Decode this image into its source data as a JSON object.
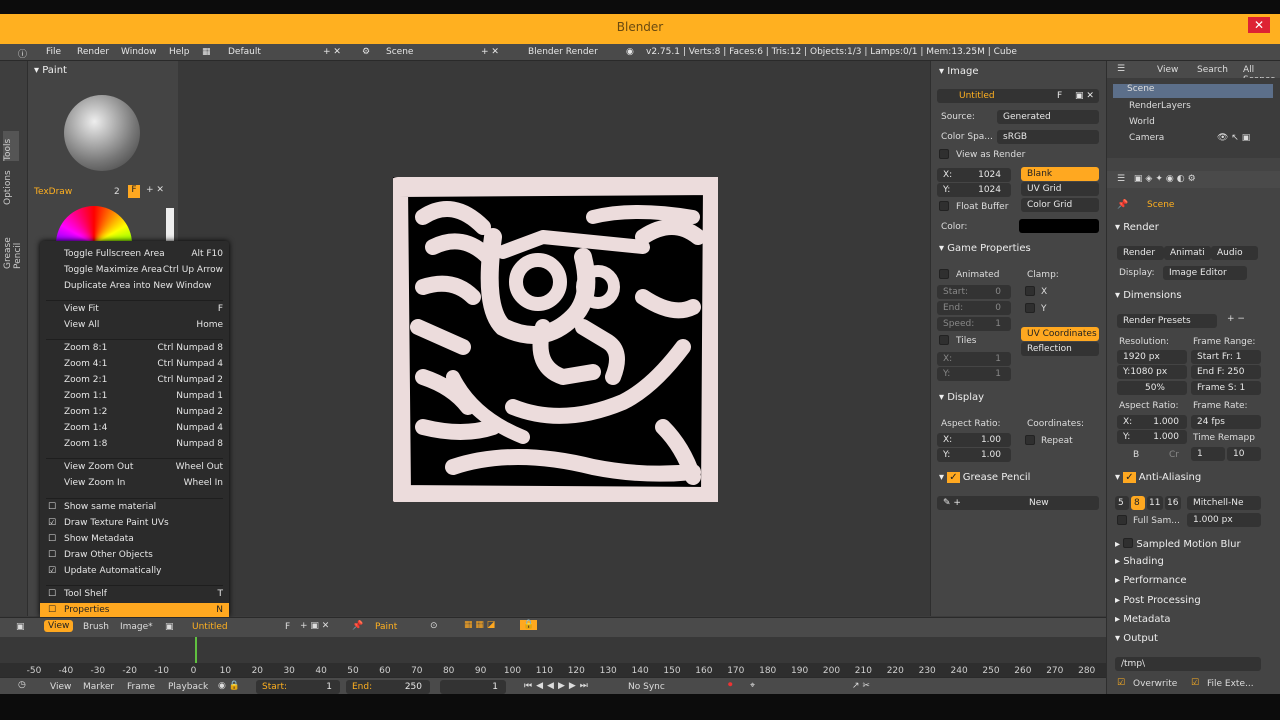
{
  "app": {
    "title": "Blender",
    "close_label": "✕"
  },
  "topbar": {
    "menus": [
      "File",
      "Render",
      "Window",
      "Help"
    ],
    "layout": "Default",
    "scene": "Scene",
    "engine": "Blender Render",
    "stats": "v2.75.1 | Verts:8 | Faces:6 | Tris:12 | Objects:1/3 | Lamps:0/1 | Mem:13.25M | Cube"
  },
  "tools": {
    "tabs": [
      "Tools",
      "Options",
      "Grease Pencil"
    ],
    "panel_title": "Paint",
    "brush_name": "TexDraw",
    "brush_users": "2",
    "brush_fake": "F"
  },
  "context_menu": {
    "items": [
      {
        "label": "Toggle Fullscreen Area",
        "key": "Alt F10"
      },
      {
        "label": "Toggle Maximize Area",
        "key": "Ctrl Up Arrow"
      },
      {
        "label": "Duplicate Area into New Window",
        "key": ""
      },
      {
        "label": "View Fit",
        "key": "F"
      },
      {
        "label": "View All",
        "key": "Home"
      },
      {
        "label": "Zoom 8:1",
        "key": "Ctrl Numpad 8"
      },
      {
        "label": "Zoom 4:1",
        "key": "Ctrl Numpad 4"
      },
      {
        "label": "Zoom 2:1",
        "key": "Ctrl Numpad 2"
      },
      {
        "label": "Zoom 1:1",
        "key": "Numpad 1"
      },
      {
        "label": "Zoom 1:2",
        "key": "Numpad 2"
      },
      {
        "label": "Zoom 1:4",
        "key": "Numpad 4"
      },
      {
        "label": "Zoom 1:8",
        "key": "Numpad 8"
      },
      {
        "label": "View Zoom Out",
        "key": "Wheel Out"
      },
      {
        "label": "View Zoom In",
        "key": "Wheel In"
      },
      {
        "label": "Show same material",
        "key": ""
      },
      {
        "label": "Draw Texture Paint UVs",
        "key": ""
      },
      {
        "label": "Show Metadata",
        "key": ""
      },
      {
        "label": "Draw Other Objects",
        "key": ""
      },
      {
        "label": "Update Automatically",
        "key": ""
      },
      {
        "label": "Tool Shelf",
        "key": "T"
      },
      {
        "label": "Properties",
        "key": "N"
      }
    ]
  },
  "image_panel": {
    "title": "Image",
    "image_name": "Untitled",
    "fake": "F",
    "source_label": "Source:",
    "source": "Generated",
    "colorspace_label": "Color Spa...",
    "colorspace": "sRGB",
    "view_as_render": "View as Render",
    "x_label": "X:",
    "x": "1024",
    "y_label": "Y:",
    "y": "1024",
    "types": [
      "Blank",
      "UV Grid",
      "Color Grid"
    ],
    "float_buffer": "Float Buffer",
    "color_label": "Color:"
  },
  "game_panel": {
    "title": "Game Properties",
    "animated": "Animated",
    "clamp": "Clamp:",
    "start": "Start:",
    "start_v": "0",
    "end": "End:",
    "end_v": "0",
    "speed": "Speed:",
    "speed_v": "1",
    "cx": "X",
    "cy": "Y",
    "tiles": "Tiles",
    "tx": "X:",
    "tx_v": "1",
    "ty": "Y:",
    "ty_v": "1",
    "mapping": [
      "UV Coordinates",
      "Reflection"
    ]
  },
  "display_panel": {
    "title": "Display",
    "aspect": "Aspect Ratio:",
    "coords": "Coordinates:",
    "ax": "X:",
    "ax_v": "1.00",
    "ay": "Y:",
    "ay_v": "1.00",
    "repeat": "Repeat"
  },
  "grease_panel": {
    "title": "Grease Pencil",
    "new": "New"
  },
  "outliner": {
    "menus": [
      "View",
      "Search",
      "All Scenes"
    ],
    "items": [
      "Scene",
      "RenderLayers",
      "World",
      "Camera"
    ]
  },
  "props": {
    "scene": "Scene",
    "render_title": "Render",
    "tabs": [
      "Render",
      "Animati",
      "Audio"
    ],
    "display_label": "Display:",
    "display": "Image Editor",
    "dimensions": "Dimensions",
    "presets": "Render Presets",
    "resolution": "Resolution:",
    "frame_range": "Frame Range:",
    "res_x": "1920 px",
    "res_y": "Y:1080 px",
    "res_pct": "50%",
    "start_fr": "Start Fr: 1",
    "end_fr": "End F: 250",
    "frame_s": "Frame S: 1",
    "aspect": "Aspect Ratio:",
    "frame_rate": "Frame Rate:",
    "asp_x": "X:",
    "asp_x_v": "1.000",
    "asp_y": "Y:",
    "asp_y_v": "1.000",
    "fps": "24 fps",
    "time_remap": "Time Remapp",
    "b": "B",
    "cr": "Cr",
    "remap_a": "1",
    "remap_b": "10",
    "aa": "Anti-Aliasing",
    "aa_samples": [
      "5",
      "8",
      "11",
      "16"
    ],
    "filter": "Mitchell-Ne",
    "full_sample": "Full Sam...",
    "filter_size": "1.000 px",
    "sections": [
      "Sampled Motion Blur",
      "Shading",
      "Performance",
      "Post Processing",
      "Metadata",
      "Output"
    ],
    "output_path": "/tmp\\",
    "overwrite": "Overwrite",
    "file_ext": "File Exte..."
  },
  "viewbar": {
    "menus": [
      "View",
      "Brush",
      "Image*"
    ],
    "image": "Untitled",
    "fake": "F",
    "mode": "Paint"
  },
  "timeline": {
    "ticks": [
      "-50",
      "-40",
      "-30",
      "-20",
      "-10",
      "0",
      "10",
      "20",
      "30",
      "40",
      "50",
      "60",
      "70",
      "80",
      "90",
      "100",
      "110",
      "120",
      "130",
      "140",
      "150",
      "160",
      "170",
      "180",
      "190",
      "200",
      "210",
      "220",
      "230",
      "240",
      "250",
      "260",
      "270",
      "280"
    ],
    "current": "1"
  },
  "tlbar": {
    "menus": [
      "View",
      "Marker",
      "Frame",
      "Playback"
    ],
    "start_label": "Start:",
    "start": "1",
    "end_label": "End:",
    "end": "250",
    "current": "1",
    "sync": "No Sync"
  }
}
